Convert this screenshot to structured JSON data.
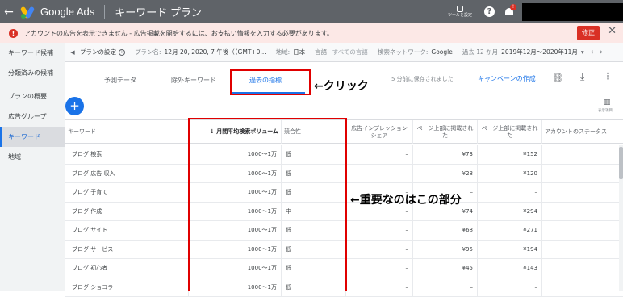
{
  "topbar": {
    "app_name": "Google Ads",
    "page_name": "キーワード プラン",
    "tools_label": "ツールと設定",
    "notification_count": "!"
  },
  "alert": {
    "text": "アカウントの広告を表示できません - 広告掲載を開始するには、お支払い情報を入力する必要があります。",
    "fix_label": "修正",
    "close": "✕"
  },
  "sidebar": {
    "items": [
      {
        "label": "キーワード候補"
      },
      {
        "label": "分類済みの候補"
      },
      {
        "label": "プランの概要"
      },
      {
        "label": "広告グループ"
      },
      {
        "label": "キーワード"
      },
      {
        "label": "地域"
      }
    ]
  },
  "settings": {
    "title": "プランの設定",
    "plan_name_label": "プラン名:",
    "plan_name": "12月 20, 2020, 7 午後（（GMT+0...",
    "region_label": "地域:",
    "region": "日本",
    "language_label": "言語:",
    "language": "すべての言語",
    "network_label": "検索ネットワーク:",
    "network": "Google",
    "period_label": "過去 12 か月",
    "period": "2019年12月～2020年11月"
  },
  "tabs": {
    "forecast": "予測データ",
    "negative": "除外キーワード",
    "historical": "過去の指標"
  },
  "annotations": {
    "click": "←クリック",
    "important": "←重要なのはこの部分"
  },
  "toolbar": {
    "saved": "5 分前に保存されました",
    "create_campaign": "キャンペーンの作成",
    "columns_label": "表示項目"
  },
  "table": {
    "headers": {
      "keyword": "キーワード",
      "volume": "↓ 月間平均検索ボリューム",
      "competition": "競合性",
      "impression_share": "広告インプレッション シェア",
      "top_bid_low": "ページ上部に掲載された",
      "top_bid_high": "ページ上部に掲載された",
      "status": "アカウントのステータス"
    },
    "rows": [
      {
        "keyword": "ブログ 検索",
        "volume": "1000～1万",
        "competition": "低",
        "share": "–",
        "low": "¥73",
        "high": "¥152"
      },
      {
        "keyword": "ブログ 広告 収入",
        "volume": "1000～1万",
        "competition": "低",
        "share": "–",
        "low": "¥28",
        "high": "¥120"
      },
      {
        "keyword": "ブログ 子育て",
        "volume": "1000～1万",
        "competition": "低",
        "share": "–",
        "low": "–",
        "high": "–"
      },
      {
        "keyword": "ブログ 作成",
        "volume": "1000～1万",
        "competition": "中",
        "share": "–",
        "low": "¥74",
        "high": "¥294"
      },
      {
        "keyword": "ブログ サイト",
        "volume": "1000～1万",
        "competition": "低",
        "share": "–",
        "low": "¥68",
        "high": "¥271"
      },
      {
        "keyword": "ブログ サービス",
        "volume": "1000～1万",
        "competition": "低",
        "share": "–",
        "low": "¥95",
        "high": "¥194"
      },
      {
        "keyword": "ブログ 初心者",
        "volume": "1000～1万",
        "competition": "低",
        "share": "–",
        "low": "¥45",
        "high": "¥143"
      },
      {
        "keyword": "ブログ ショコラ",
        "volume": "1000～1万",
        "competition": "低",
        "share": "–",
        "low": "–",
        "high": "–"
      }
    ]
  },
  "colors": {
    "topbar": "#5f6368",
    "accent": "#1a73e8",
    "alert_bg": "#fce8e6",
    "error": "#d93025",
    "annotation_red": "#e00000"
  }
}
